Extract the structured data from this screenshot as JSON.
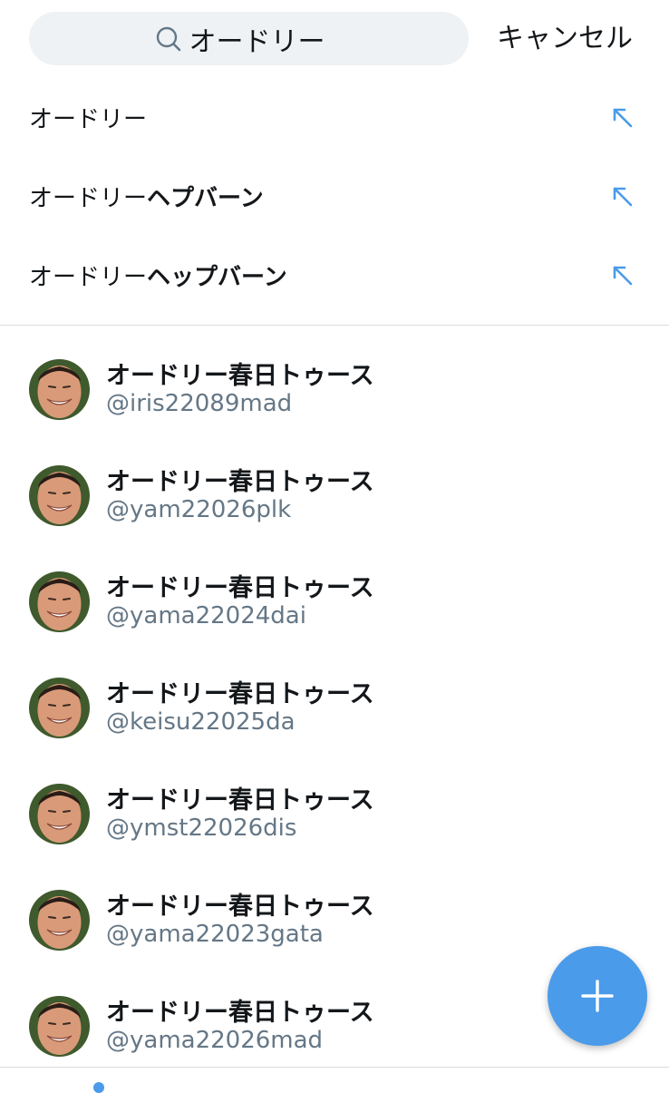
{
  "search": {
    "value": "オードリー",
    "icon": "search-icon"
  },
  "cancel_label": "キャンセル",
  "suggestions": [
    {
      "prefix": "オードリー",
      "suffix": ""
    },
    {
      "prefix": "オードリー",
      "suffix": "ヘプバーン"
    },
    {
      "prefix": "オードリー",
      "suffix": "ヘップバーン"
    }
  ],
  "users": [
    {
      "name": "オードリー春日トゥース",
      "handle": "@iris22089mad"
    },
    {
      "name": "オードリー春日トゥース",
      "handle": "@yam22026plk"
    },
    {
      "name": "オードリー春日トゥース",
      "handle": "@yama22024dai"
    },
    {
      "name": "オードリー春日トゥース",
      "handle": "@keisu22025da"
    },
    {
      "name": "オードリー春日トゥース",
      "handle": "@ymst22026dis"
    },
    {
      "name": "オードリー春日トゥース",
      "handle": "@yama22023gata"
    },
    {
      "name": "オードリー春日トゥース",
      "handle": "@yama22026mad"
    }
  ],
  "colors": {
    "accent": "#4a9be9",
    "text": "#14171a",
    "secondary_text": "#657786",
    "search_background": "#eff2f4"
  }
}
